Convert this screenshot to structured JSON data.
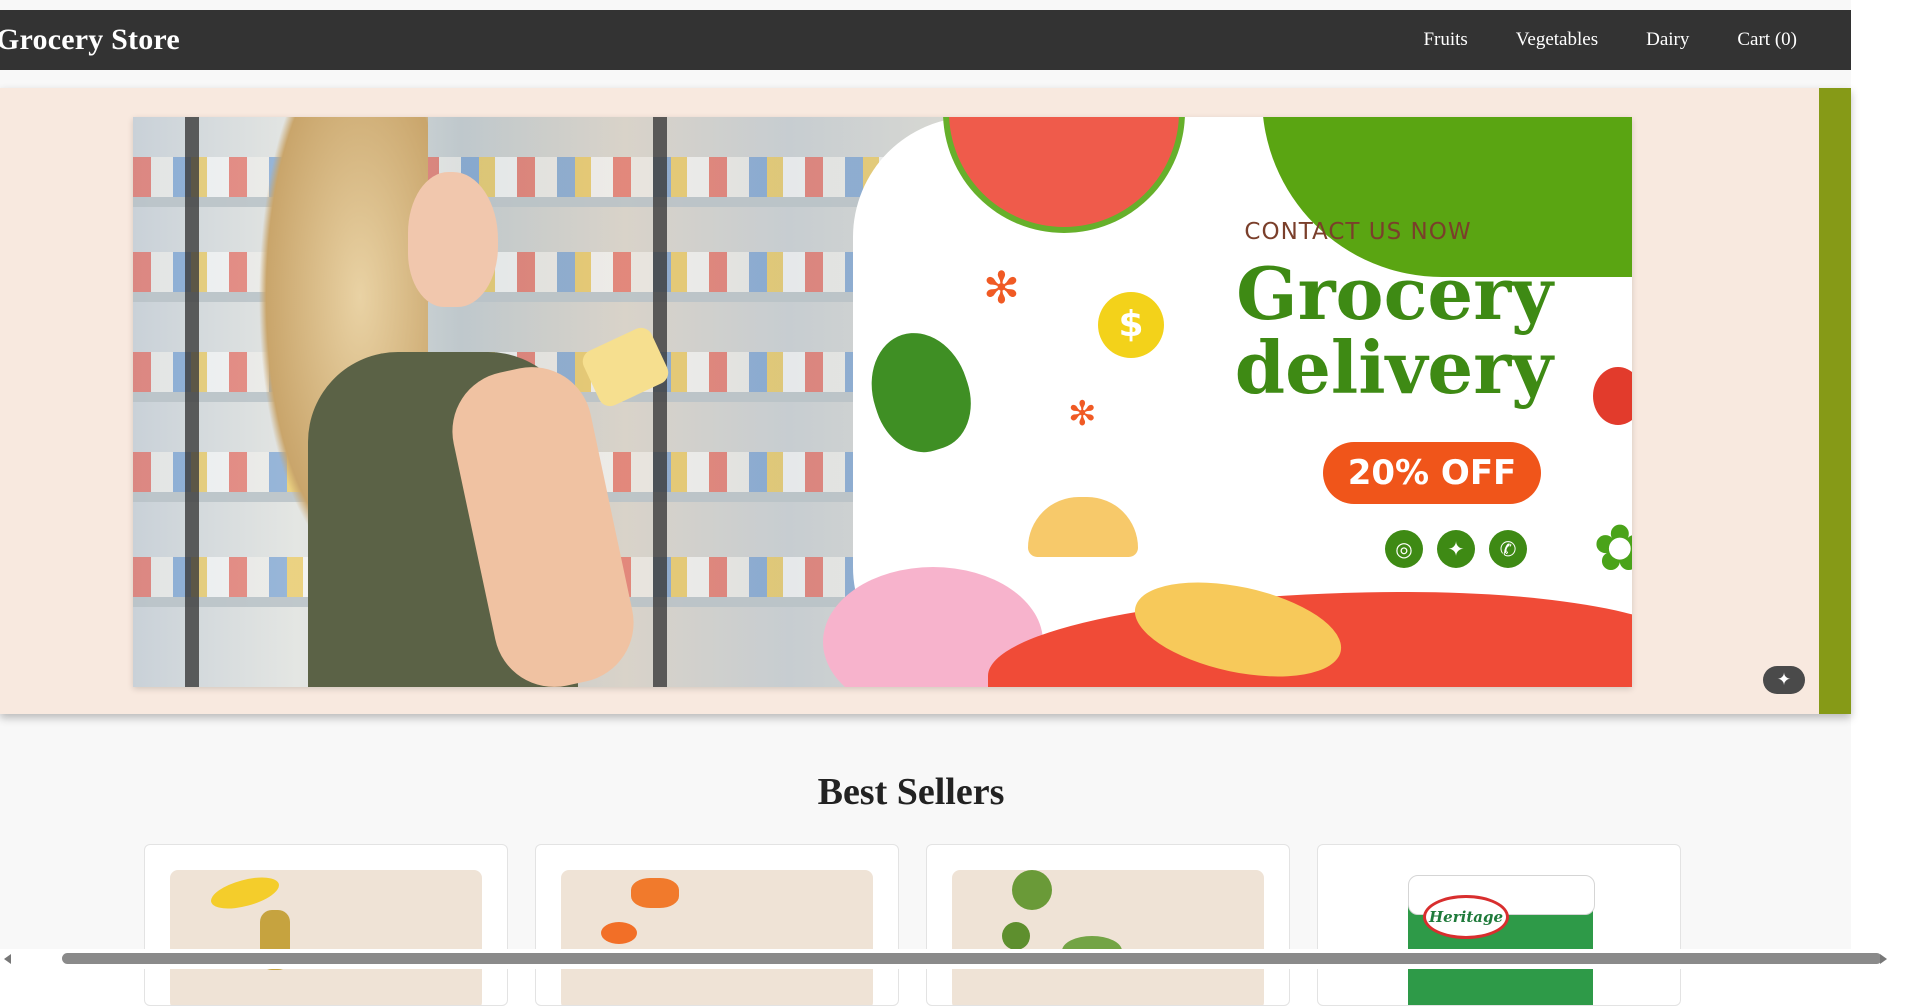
{
  "header": {
    "brand": "Grocery Store",
    "nav": [
      "Fruits",
      "Vegetables",
      "Dairy",
      "Cart (0)"
    ]
  },
  "banner": {
    "contact": "CONTACT US NOW",
    "headline_line1": "Grocery",
    "headline_line2": "delivery",
    "offer": "20% OFF",
    "coin_symbol": "$",
    "socials": [
      "instagram-icon",
      "twitter-icon",
      "whatsapp-icon"
    ],
    "colors": {
      "green": "#3e8a14",
      "orange": "#f0551a",
      "accent": "#869a17"
    }
  },
  "best_sellers": {
    "title": "Best Sellers",
    "milk_brand": "Heritage"
  }
}
